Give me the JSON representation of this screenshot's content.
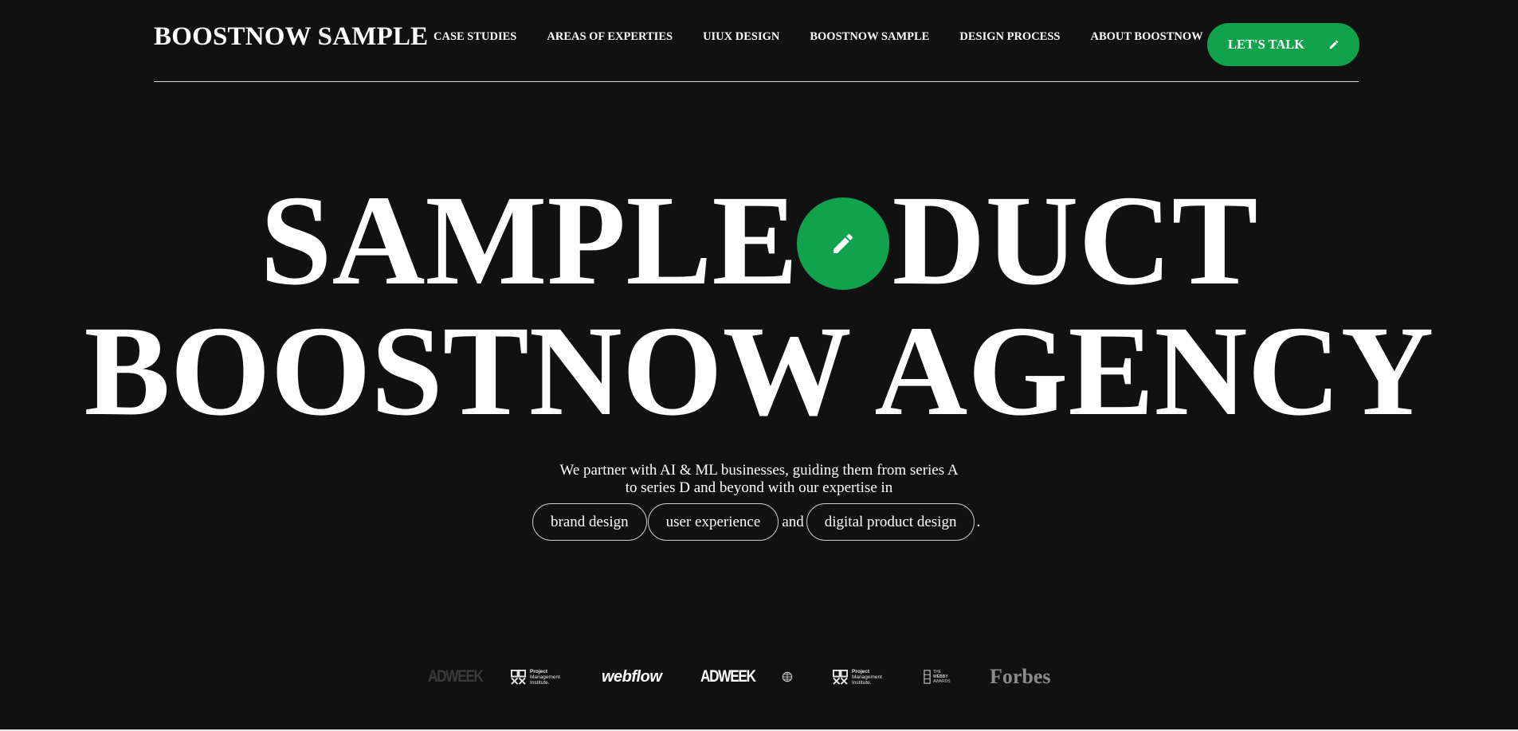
{
  "header": {
    "brand": "BOOSTNOW SAMPLE",
    "nav": [
      {
        "label": "CASE STUDIES"
      },
      {
        "label": "AREAS OF EXPERTIES"
      },
      {
        "label": "UIUX DESIGN"
      },
      {
        "label": "BOOSTNOW SAMPLE"
      },
      {
        "label": "DESIGN PROCESS"
      },
      {
        "label": "ABOUT BOOSTNOW"
      }
    ],
    "cta_label": "LET'S TALK",
    "cta_icon": "pencil-icon"
  },
  "hero": {
    "line1_left": "SAMPLE",
    "line1_right": "DUCT",
    "line2": "BOOSTNOW AGENCY",
    "badge_icon": "pencil-icon",
    "subtitle_line1": "We partner with AI & ML businesses, guiding them from series A",
    "subtitle_line2": "to series D and beyond with our expertise in",
    "pills": [
      "brand design",
      "user experience",
      "digital product design"
    ],
    "connector": "and",
    "end_punct": "."
  },
  "logos": {
    "adweek_dim": "ADWEEK",
    "pmi_1": {
      "line1": "Project",
      "line2": "Management",
      "line3": "Institute."
    },
    "webflow": "webflow",
    "adweek": "ADWEEK",
    "pmi_2": {
      "line1": "Project",
      "line2": "Management",
      "line3": "Institute."
    },
    "webby": {
      "line1": "THE",
      "line2": "WEBBY",
      "line3": "AWARDS"
    },
    "forbes": "Forbes"
  },
  "colors": {
    "background": "#111111",
    "accent": "#10a24c",
    "text": "#ffffff"
  }
}
